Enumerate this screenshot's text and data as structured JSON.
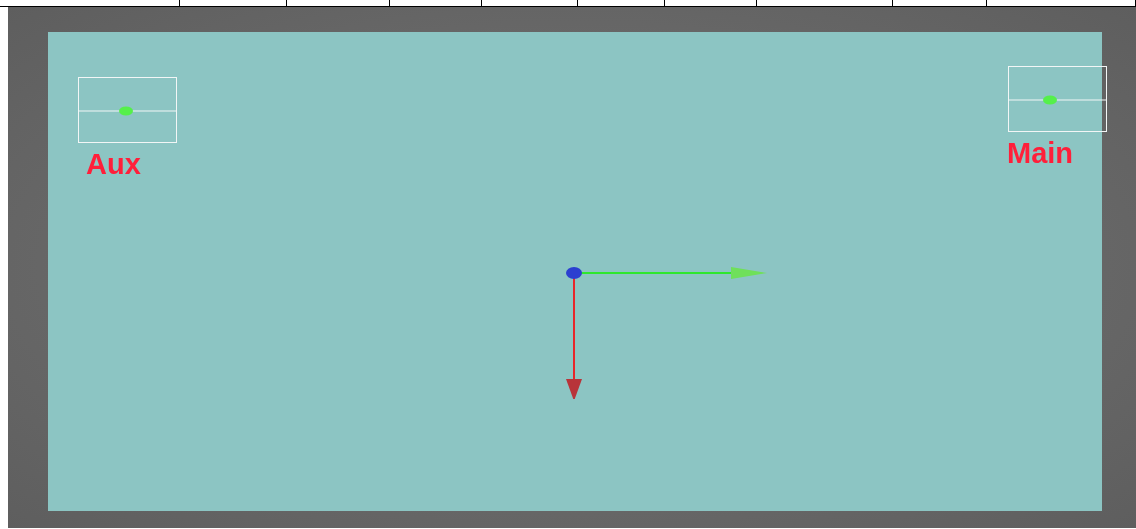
{
  "viewport": {
    "markers": [
      {
        "label": "Aux"
      },
      {
        "label": "Main"
      }
    ]
  }
}
